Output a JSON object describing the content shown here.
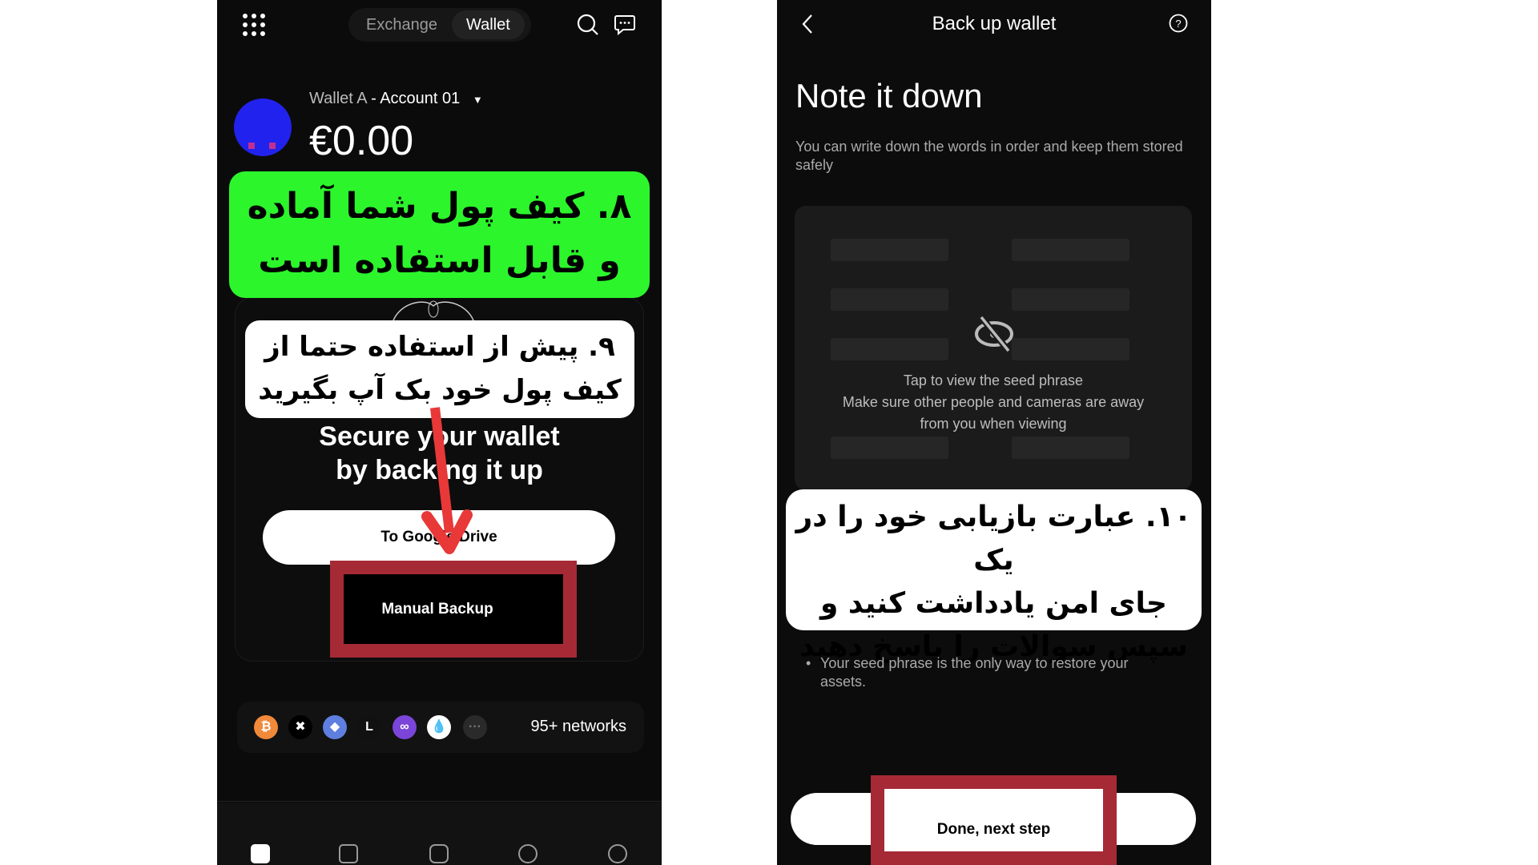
{
  "left_screen": {
    "tabs": [
      {
        "label": "Exchange",
        "active": false
      },
      {
        "label": "Wallet",
        "active": true
      }
    ],
    "icons": {
      "menu": "grid-menu-icon",
      "search": "search-icon",
      "messages": "chat-icon"
    },
    "account_name": "Wallet A",
    "account_sep": " - ",
    "account_sub": "Account 01",
    "balance": "€0.00",
    "annotation_8": [
      "۸. کیف پول شما آماده",
      "و قابل استفاده است"
    ],
    "annotation_9": [
      "۹. پیش از استفاده حتما از",
      "کیف پول خود بک آپ بگیرید"
    ],
    "secure_title": "Secure your wallet by backing it up",
    "google_drive_button": "To Google Drive",
    "manual_backup_button": "Manual Backup",
    "networks_label": "95+ networks",
    "network_icons": [
      "bitcoin",
      "okx",
      "ethereum",
      "linea",
      "polygon",
      "sui",
      "more"
    ],
    "bottom_nav": [
      "home-icon",
      "trade-icon",
      "web3-icon",
      "defi-icon",
      "discover-icon"
    ],
    "highlight_color": "#a52a35",
    "arrow_color": "#e83838",
    "annotation_green": "#2cf52c"
  },
  "right_screen": {
    "header_title": "Back up wallet",
    "title": "Note it down",
    "subtitle": "You can write down the words in order and keep them stored safely",
    "seed_tap": "Tap to view the seed phrase",
    "seed_warning": "Make sure other people and cameras are away from you when viewing",
    "annotation_10": [
      "۱۰. عبارت بازیابی خود را در یک",
      "جای امن یادداشت کنید و",
      "سپس سوالات را پاسخ دهید"
    ],
    "bullet": "Your seed phrase is the only way to restore your assets.",
    "done_button": "Done, next step"
  }
}
